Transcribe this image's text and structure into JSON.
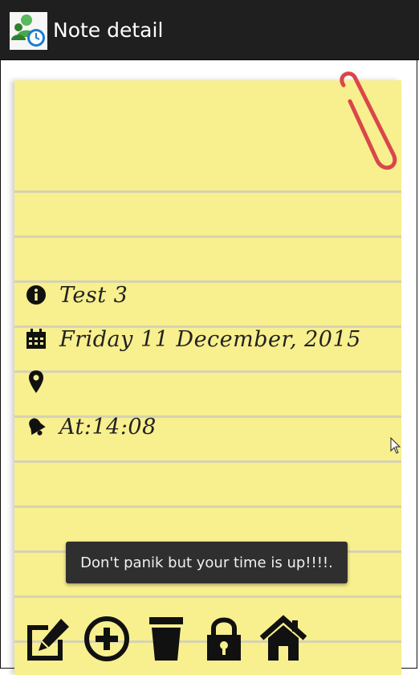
{
  "actionbar": {
    "title": "Note detail",
    "app_icon": "app-users-clock-icon"
  },
  "note": {
    "title": "Test 3",
    "date": "Friday 11 December, 2015",
    "location": "",
    "alarm": "At:14:08",
    "icons": [
      "info-icon",
      "calendar-icon",
      "location-pin-icon",
      "bell-icon"
    ]
  },
  "toast": {
    "message": "Don't panik but your time is up!!!!."
  },
  "toolbar": {
    "buttons": [
      "edit-icon",
      "add-circle-icon",
      "trash-icon",
      "lock-icon",
      "home-icon"
    ]
  },
  "colors": {
    "paper": "#f8ef8e",
    "paper_lines": "#d6d2b2",
    "actionbar": "#1f1f1f",
    "clip": "#d9474a",
    "toast": "#2f2f2f"
  }
}
